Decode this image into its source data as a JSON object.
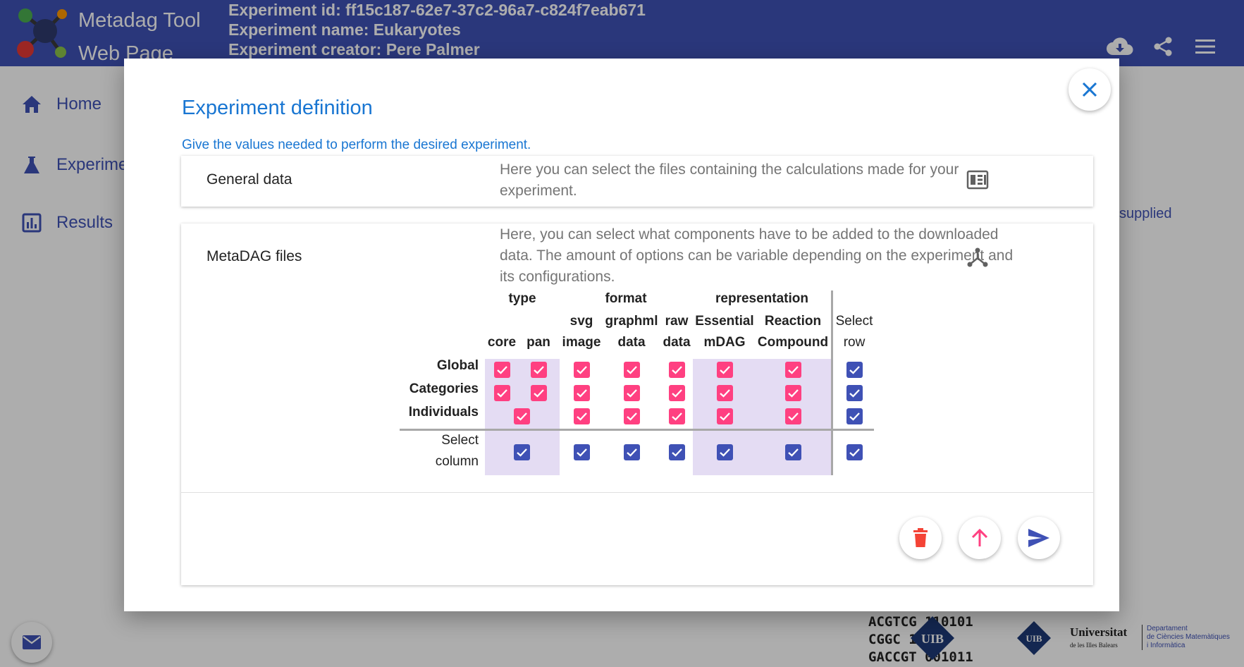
{
  "app": {
    "title_line1": "Metadag Tool",
    "title_line2": "Web Page",
    "experiment_id": "Experiment id: ff15c187-62e7-37c2-96a7-c824f7eab671",
    "experiment_name": "Experiment name: Eukaryotes",
    "experiment_creator": "Experiment creator: Pere Palmer"
  },
  "sidebar": {
    "items": [
      {
        "label": "Home",
        "icon": "home-icon"
      },
      {
        "label": "Experime",
        "icon": "flask-icon"
      },
      {
        "label": "Results",
        "icon": "chart-icon"
      }
    ]
  },
  "background": {
    "supplied_text": "supplied",
    "footer_dna": [
      "ACGTCG 110101",
      "CGGC 1100",
      "GACCGT 001011"
    ],
    "footer_uib": "UIB",
    "footer_university": "Universitat",
    "footer_university_sub": "de les Illes Balears",
    "footer_department": [
      "Departament",
      "de Ciències Matemàtiques",
      "i Informàtica"
    ]
  },
  "dialog": {
    "title": "Experiment definition",
    "subtitle": "Give the values needed to perform the desired experiment.",
    "panels": [
      {
        "title": "General data",
        "description": "Here you can select the files containing the calculations made for your experiment.",
        "icon": "table-view-icon"
      },
      {
        "title": "MetaDAG files",
        "description": "Here, you can select what components have to be added to the downloaded data. The amount of options can be variable depending on the experiment and its configurations.",
        "icon": "hub-icon"
      }
    ],
    "table": {
      "groups": {
        "type": "type",
        "format": "format",
        "representation": "representation"
      },
      "columns": {
        "core": "core",
        "pan": "pan",
        "svg_1": "svg",
        "svg_2": "image",
        "graphml_1": "graphml",
        "graphml_2": "data",
        "raw_1": "raw",
        "raw_2": "data",
        "essential_1": "Essential",
        "essential_2": "mDAG",
        "reaction_1": "Reaction",
        "reaction_2": "Compound",
        "select_row_1": "Select",
        "select_row_2": "row"
      },
      "rows": {
        "global": "Global",
        "categories": "Categories",
        "individuals": "Individuals",
        "select_column_1": "Select",
        "select_column_2": "column"
      },
      "checked": {
        "global": {
          "core": true,
          "pan": true,
          "svg": true,
          "graphml": true,
          "raw": true,
          "essential": true,
          "reaction": true,
          "row": true
        },
        "categories": {
          "core": true,
          "pan": true,
          "svg": true,
          "graphml": true,
          "raw": true,
          "essential": true,
          "reaction": true,
          "row": true
        },
        "individuals": {
          "type": true,
          "svg": true,
          "graphml": true,
          "raw": true,
          "essential": true,
          "reaction": true,
          "row": true
        },
        "select_column": {
          "type": true,
          "svg": true,
          "graphml": true,
          "raw": true,
          "essential": true,
          "reaction": true,
          "all": true
        }
      }
    },
    "actions": [
      {
        "name": "delete",
        "icon": "trash-icon",
        "color": "#f44336"
      },
      {
        "name": "upload",
        "icon": "arrow-up-icon",
        "color": "#ff4081"
      },
      {
        "name": "send",
        "icon": "send-icon",
        "color": "#3f51b5"
      }
    ]
  },
  "colors": {
    "primary": "#3f51b5",
    "accent": "#ff4081",
    "title_blue": "#1976d2",
    "band": "#e4dcf3",
    "warn": "#f44336"
  }
}
